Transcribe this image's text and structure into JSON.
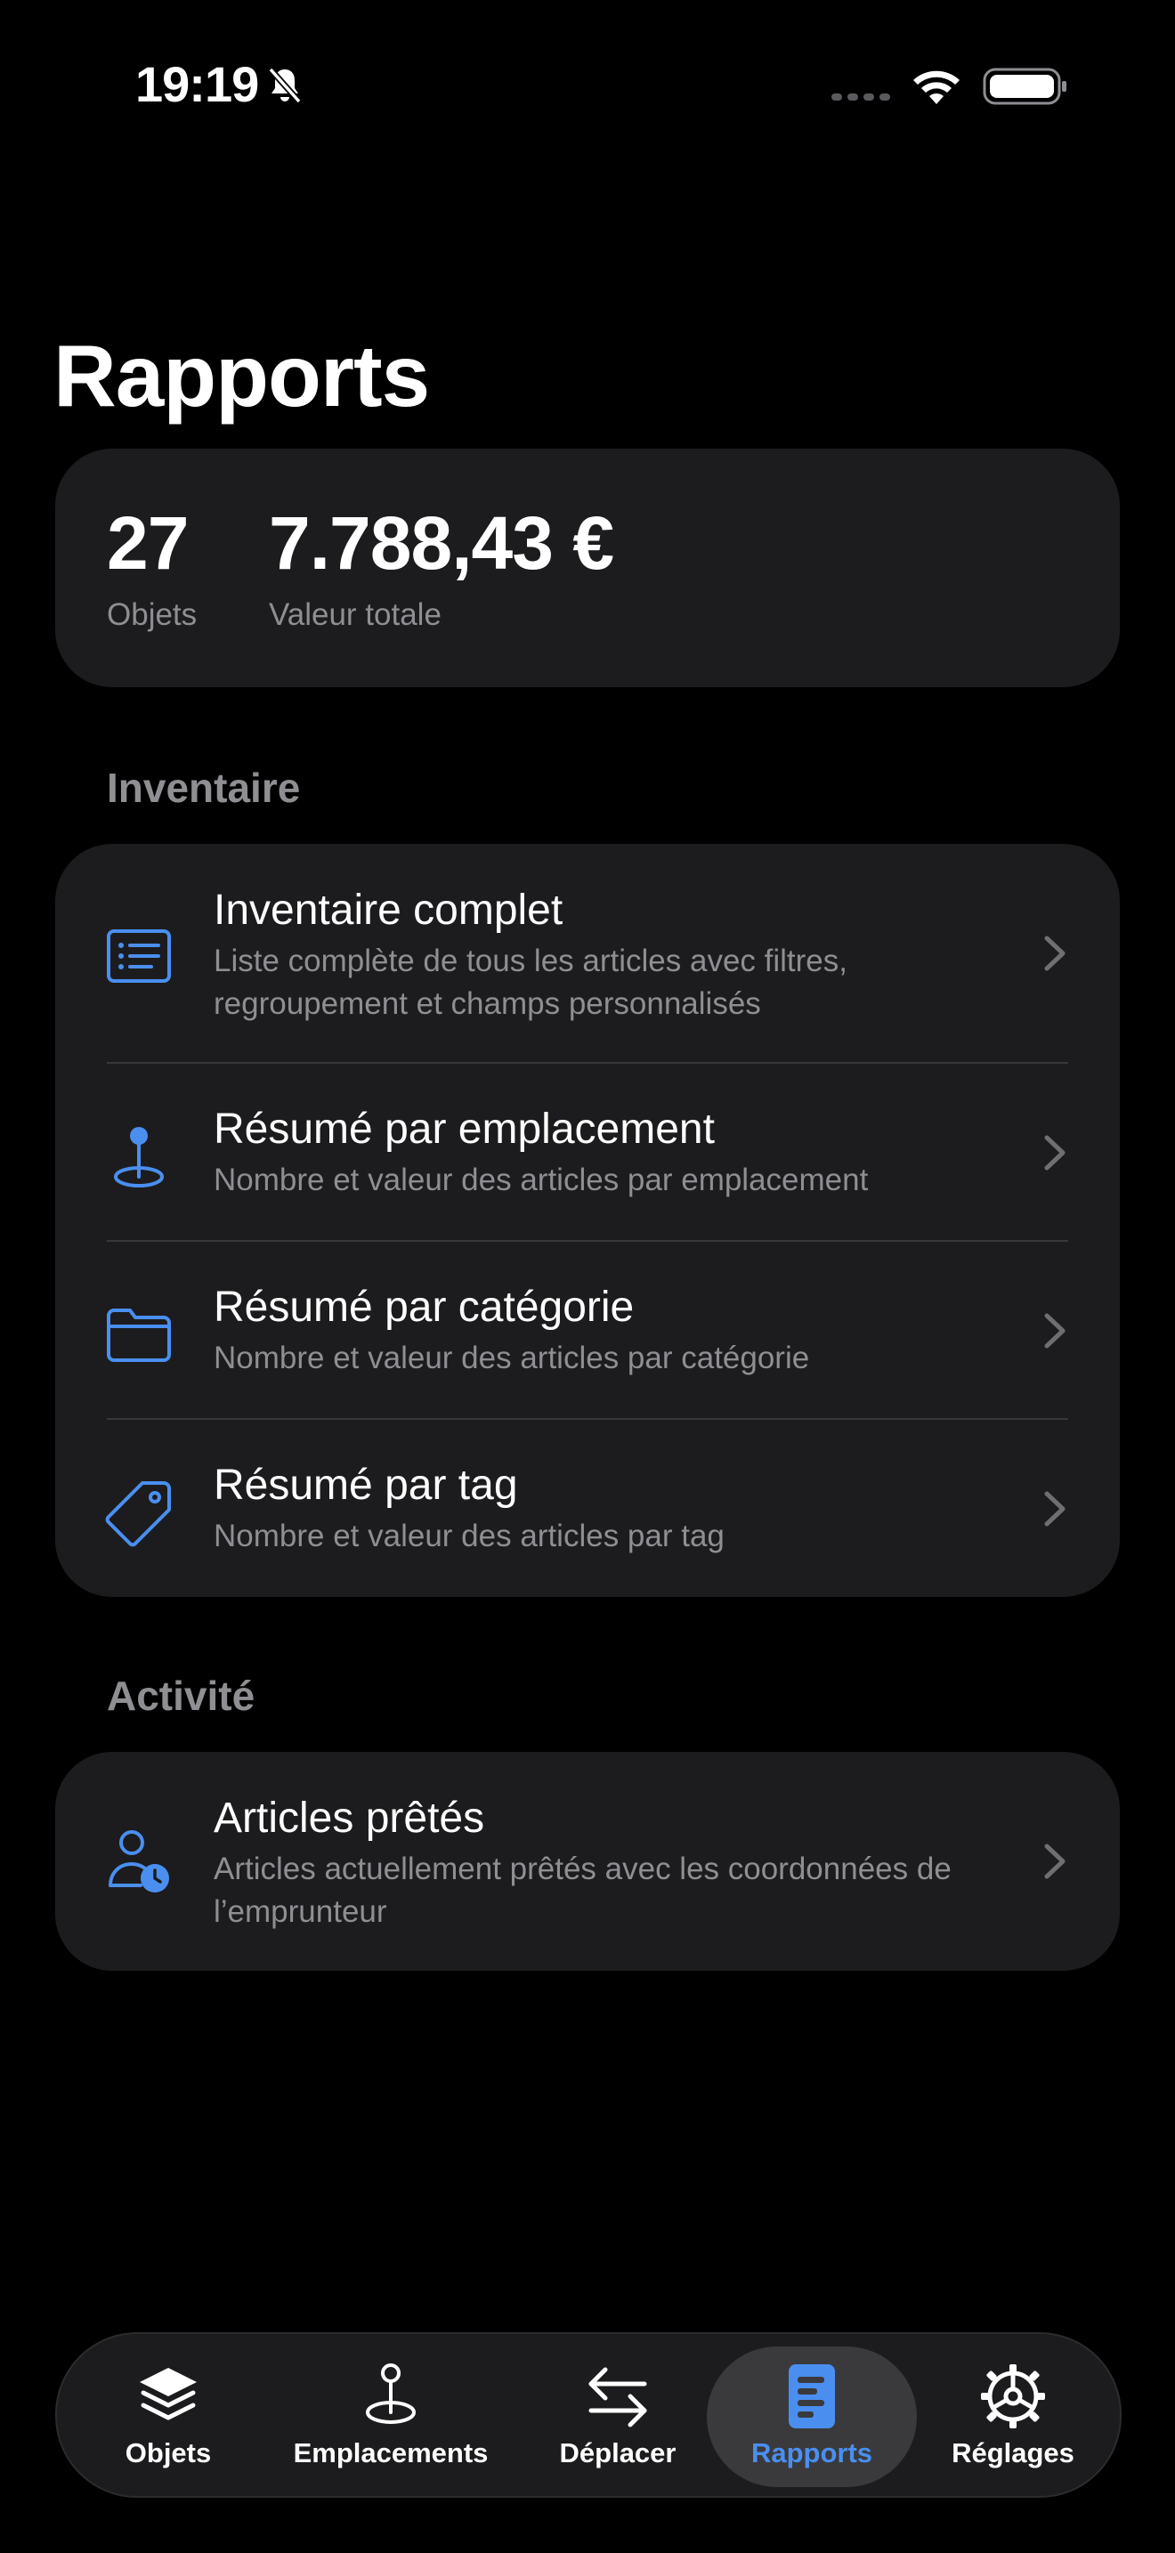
{
  "status_bar": {
    "time": "19:19",
    "icons": [
      "bell-slash-icon",
      "signal-icon",
      "wifi-icon",
      "battery-icon"
    ]
  },
  "page": {
    "title": "Rapports"
  },
  "stats": {
    "count_value": "27",
    "count_label": "Objets",
    "total_value": "7.788,43 €",
    "total_label": "Valeur totale"
  },
  "sections": {
    "inventory": {
      "header": "Inventaire",
      "items": [
        {
          "icon": "list-icon",
          "title": "Inventaire complet",
          "subtitle": "Liste complète de tous les articles avec filtres, regroupement et champs personnalisés"
        },
        {
          "icon": "location-pin-icon",
          "title": "Résumé par emplacement",
          "subtitle": "Nombre et valeur des articles par emplacement"
        },
        {
          "icon": "folder-icon",
          "title": "Résumé par catégorie",
          "subtitle": "Nombre et valeur des articles par catégorie"
        },
        {
          "icon": "tag-icon",
          "title": "Résumé par tag",
          "subtitle": "Nombre et valeur des articles par tag"
        }
      ]
    },
    "activity": {
      "header": "Activité",
      "items": [
        {
          "icon": "person-clock-icon",
          "title": "Articles prêtés",
          "subtitle": "Articles actuellement prêtés avec les coordonnées de l’emprunteur"
        }
      ]
    }
  },
  "tab_bar": {
    "active_tab": "Rapports",
    "accent_color": "#4a8ff0",
    "tabs": [
      {
        "label": "Objets",
        "icon": "layers-icon"
      },
      {
        "label": "Emplacements",
        "icon": "location-pin-icon"
      },
      {
        "label": "Déplacer",
        "icon": "arrows-left-right-icon"
      },
      {
        "label": "Rapports",
        "icon": "report-doc-icon"
      },
      {
        "label": "Réglages",
        "icon": "gear-icon"
      }
    ]
  }
}
